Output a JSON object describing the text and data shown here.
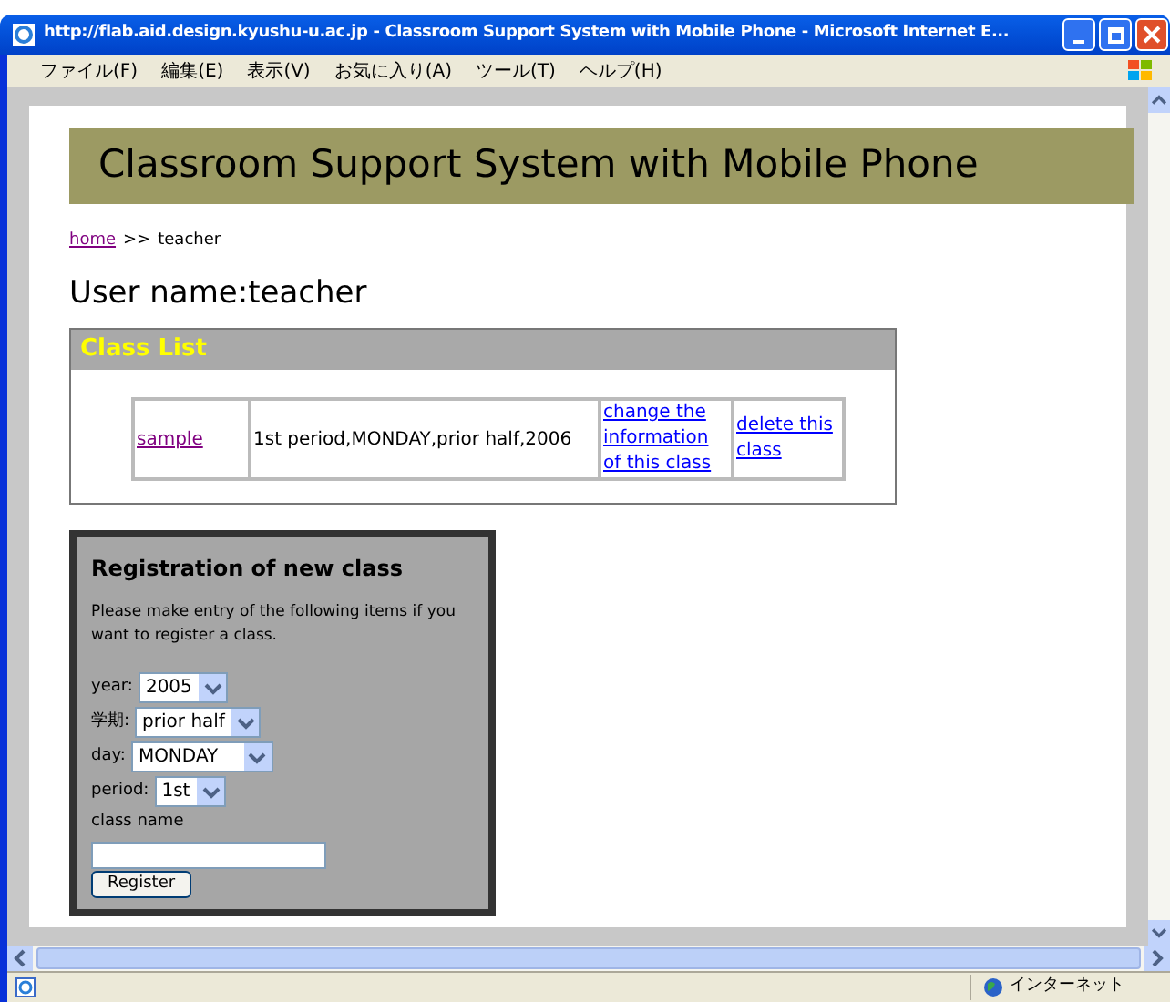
{
  "window": {
    "title": "http://flab.aid.design.kyushu-u.ac.jp - Classroom Support System with Mobile Phone - Microsoft Internet E..."
  },
  "menu": [
    "ファイル(F)",
    "編集(E)",
    "表示(V)",
    "お気に入り(A)",
    "ツール(T)",
    "ヘルプ(H)"
  ],
  "page": {
    "banner": "Classroom Support System with Mobile Phone",
    "breadcrumb": {
      "link": "home",
      "separator": ">>",
      "current": "teacher"
    },
    "user_heading": "User name:teacher",
    "class_list": {
      "title": "Class List",
      "rows": [
        {
          "name": "sample",
          "info": "1st period,MONDAY,prior half,2006",
          "change_link": "change the information of this class",
          "delete_link": "delete this class"
        }
      ]
    },
    "registration": {
      "title": "Registration of new class",
      "instructions": "Please make entry of the following items if you want to register a class.",
      "fields": [
        {
          "kind": "select",
          "label": "year:",
          "value": "2005"
        },
        {
          "kind": "select",
          "label": "学期:",
          "value": "prior half"
        },
        {
          "kind": "select",
          "label": "day:",
          "value": "MONDAY",
          "wide": true
        },
        {
          "kind": "select",
          "label": "period:",
          "value": "1st"
        },
        {
          "kind": "text",
          "label": "class name"
        }
      ],
      "button": "Register"
    }
  },
  "status_bar": {
    "zone": "インターネット"
  }
}
